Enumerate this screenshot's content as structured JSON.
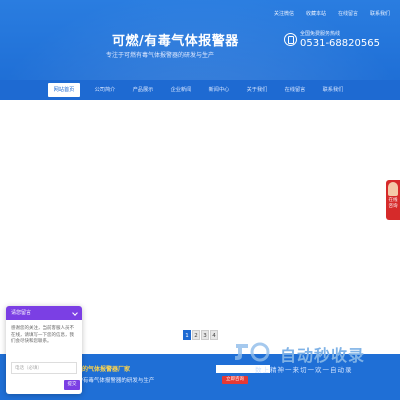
{
  "header": {
    "top_links": [
      "关注微信",
      "收藏本站",
      "在线留言",
      "联系我们"
    ],
    "title": "可燃/有毒气体报警器",
    "subtitle": "专注于可燃有毒气体报警器的研发与生产",
    "hotline_label": "全国免费服务热线",
    "hotline_number": "0531-68820565"
  },
  "nav": {
    "items": [
      "网站首页",
      "公司简介",
      "产品展示",
      "企业新闻",
      "新闻中心",
      "关于我们",
      "在线留言",
      "联系我们"
    ],
    "active": 0
  },
  "pager": [
    "1",
    "2",
    "3",
    "4"
  ],
  "banner": {
    "title": "齐全的气体报警器厂家",
    "subtitle": "可燃/有毒气体报警器的研发与生产",
    "button": "立即咨询"
  },
  "watermark": {
    "text": "自动秒收录",
    "sub": "数上精神一来切一欢一自动录"
  },
  "float_service": {
    "label": "在线咨询"
  },
  "chat": {
    "header": "请您留言",
    "message": "感谢您的关注，当前客服人员不在线，请填写一下您的信息，我们会尽快和您联系。",
    "input_placeholder": "电话（必填）",
    "send": "提交"
  },
  "colors": {
    "primary": "#1f6fd6",
    "nav": "#1e6ad2",
    "chat_accent": "#7b3fe4",
    "service": "#d62a2a"
  }
}
